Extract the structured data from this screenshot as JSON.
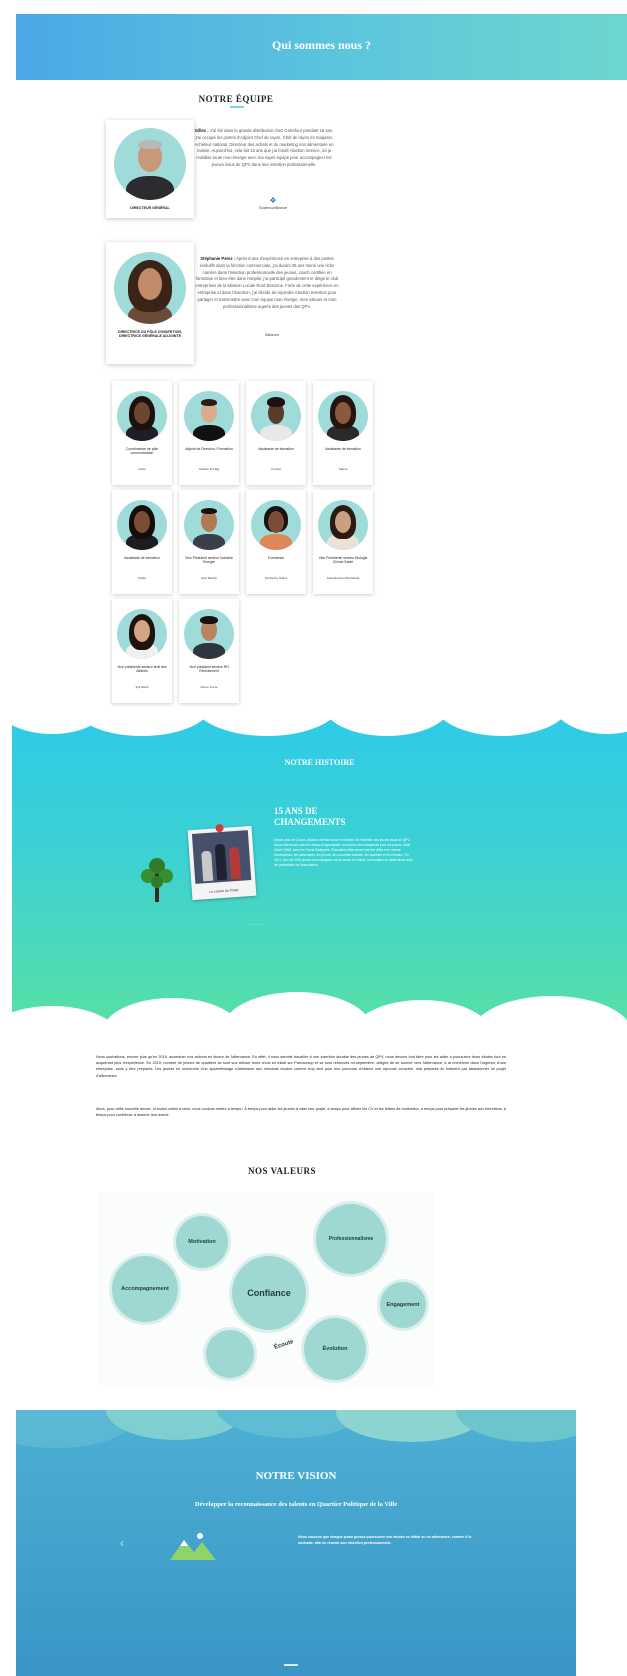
{
  "hero": {
    "title": "Qui sommes nous ?"
  },
  "equipe": {
    "title": "NOTRE ÉQUIPE",
    "leaders": [
      {
        "role": "DIRECTEUR GÉNÉRAL",
        "bio_name": "Gilles :",
        "bio": "J'ai été dans la grande distribution chez Carrefour pendant 15 ans. J'ai occupé les postes d'Adjoint Chef de rayon, Chef de rayon en magasin, Acheteur national, Directeur des achats et du marketing non alimentaire en Suisse. Aujourd'hui, cela fait 15 ans que j'ai fondé Alaction Service, où je mobilise toute mon énergie avec ma super équipe pour accompagner les jeunes issus de QPV dans leur insertion professionnelle.",
        "logo": "Sodexo/alliance"
      },
      {
        "role": "DIRECTRICE DU PÔLE D'INSERTION, DIRECTRICE GÉNÉRALE ADJOINTE",
        "bio_name": "Stéphanie Perez :",
        "bio": "Après 8 ans d'expérience en entreprise à des postes évolutifs dans la fonction commerciale, j'ai durant 28 ans mené une riche carrière dans l'insertion professionnelle des jeunes, coach certifiée en formation et bien-être dans l'emploi, j'ai participé grandement et dirigé le club entreprises de la Mission Locale Nord Essonne. Forte de cette expérience en entreprise et dans l'insertion, j'ai décidé de rejoindre Alaction Insertion pour partager et transmettre avec mon équipe mon énergie, mes valeurs et mon professionnalisme auprès des jeunes des QPV.",
        "logo": "Alliance"
      }
    ],
    "members": [
      {
        "role": "Coordinatrice de pôle communication",
        "name": "Chloé"
      },
      {
        "role": "Adjoint de Direction / Formation",
        "name": "Sofiane El Hajji"
      },
      {
        "role": "Assistante de formation",
        "name": "Kendel"
      },
      {
        "role": "Assistante de formation",
        "name": "Salma"
      },
      {
        "role": "Assistante de formation",
        "name": "Nadia"
      },
      {
        "role": "Vice Président secteur Industrie Énergie",
        "name": "Ilyès Bachiri"
      },
      {
        "role": "Formatrice",
        "name": "Kimberley Diarra"
      },
      {
        "role": "Vice Présidente secteur Biologie Chimie Santé",
        "name": "Aïda Bouchra Benhadda"
      },
      {
        "role": "Vice présidente secteur droit des Affaires",
        "name": "Ilya Mehli"
      },
      {
        "role": "Vice président secteur RH Recrutement",
        "name": "Moron Fonte"
      }
    ]
  },
  "histoire": {
    "title": "NOTRE HISTOIRE",
    "subtitle": "15 ANS DE CHANGEMENTS",
    "text": "Depuis plus de 15 ans, Alaction Service œuvre en faveur de l'insertion des jeunes issus de QPV. Nous intervenons avec le réseau d'organisation au service des entreprises pour les jeunes. Alain Alexer 2008, avec les Points Ralliquent, l'Éducation Mise œuvre par les Villes et le monde d'entreprises, les partenaires, les jeunes, les nouvelles salariés, les quartiers et les réseaux. En 2021, plus de 2000 jeunes accompagnés ont eu accès à l'emploi, la formation ou l'alternance avec les partenaires de l'association.",
    "photo_caption": "Le sachet du Projet",
    "footnote": "— — — — —"
  },
  "paragraph": {
    "p1": "Nous souhaitons, encore plus qu'en 2019, accentuer nos actions en faveur de l'alternance. En effet, il nous semble travailler à une insertion durable des jeunes de QPV, nous devons tout faire pour les aider à poursuivre leurs études tout en acquérant plus d'expérience. En 2019, nombre de jeunes de quartiers se sont vus refuser leurs choix en initial sur Parcoursup et se sont retrouvés mi-septembre, obligés de se tourner vers l'alternance, à la recherche dans l'urgence d'une entreprise, sans y être préparés. Les jeunes en recherche d'un apprentissage s'adressent aux missions locales comme trop tard pour leur parcours d'obtenir une réponse concrète, mal préparés ils finissent par abandonner ce projet d'alternance.",
    "p2": "Alors, pour cette nouvelle année, ni toutes celles à venir, nous voulons mettre à temps ! À temps pour aider les jeunes à caler leur projet, à temps pour affiner les CV et les lettres de motivation, à temps pour préparer les jeunes aux entretiens, à temps pour contribuer à assurer leur avenir."
  },
  "valeurs": {
    "title": "NOS VALEURS",
    "items": [
      "Motivation",
      "Professionnalisme",
      "Accompagnement",
      "Confiance",
      "Engagement",
      "Écoute",
      "Évolution"
    ]
  },
  "vision": {
    "title": "NOTRE VISION",
    "subtitle": "Développer la reconnaissance des talents en Quartier Politique de la Ville",
    "text": "Nous voulons que chaque jeune puisse poursuivre ses études en initial ou en alternance, comme il le souhaite, afin de réussir son insertion professionnelle.",
    "prev_icon": "chevron-left-icon"
  },
  "colors": {
    "accent": "#5cc6dc",
    "bubble": "#9fd8d2",
    "history": "#3dd1d3"
  }
}
